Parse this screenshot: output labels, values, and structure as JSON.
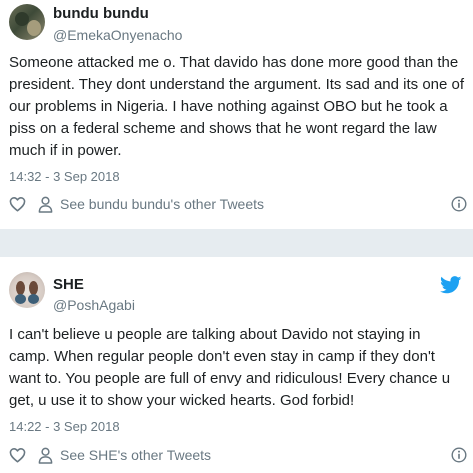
{
  "tweets": [
    {
      "name": "bundu bundu",
      "handle": "@EmekaOnyenacho",
      "text": "Someone attacked me o. That davido has done more good than the president. They dont understand the argument. Its sad and its one of our problems in Nigeria. I have nothing against OBO but he took a piss on a federal scheme and shows that he wont regard the law much if in power.",
      "timestamp": "14:32 - 3 Sep 2018",
      "other_tweets_label": "See bundu bundu's other Tweets",
      "icons": [
        "heart-icon",
        "person-icon",
        "info-icon"
      ]
    },
    {
      "name": "SHE",
      "handle": "@PoshAgabi",
      "text": "I can't believe u people are talking about Davido not staying in camp. When regular people don't even stay in camp if they don't want to. You people are full of envy and ridiculous! Every chance u get, u use it to show your wicked hearts. God forbid!",
      "timestamp": "14:22 - 3 Sep 2018",
      "other_tweets_label": "See SHE's other Tweets",
      "icons": [
        "twitter-bird-icon",
        "heart-icon",
        "person-icon",
        "info-icon"
      ]
    }
  ],
  "colors": {
    "text": "#1c2022",
    "muted": "#697882",
    "twitter_blue": "#1da1f2",
    "separator": "#e6ecf0"
  }
}
